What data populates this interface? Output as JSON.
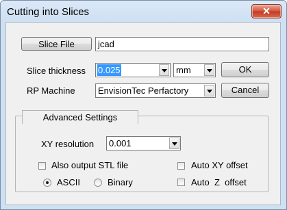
{
  "window": {
    "title": "Cutting into Slices",
    "close_glyph": "✕"
  },
  "slice_file": {
    "button_label": "Slice File",
    "value": "jcad"
  },
  "slice_thickness": {
    "label": "Slice thickness",
    "value": "0.025",
    "unit": "mm"
  },
  "rp_machine": {
    "label": "RP Machine",
    "value": "EnvisionTec Perfactory"
  },
  "buttons": {
    "ok": "OK",
    "cancel": "Cancel"
  },
  "advanced": {
    "tab_label": "Advanced Settings",
    "xy_resolution": {
      "label": "XY resolution",
      "value": "0.001"
    },
    "also_output_stl": {
      "label": "Also output STL file",
      "checked": false
    },
    "format": {
      "ascii_label": "ASCII",
      "binary_label": "Binary",
      "selected": "ASCII"
    },
    "auto_xy_offset": {
      "label": "Auto XY offset",
      "checked": false
    },
    "auto_z_offset": {
      "label": "Auto  Z  offset",
      "checked": false
    }
  }
}
